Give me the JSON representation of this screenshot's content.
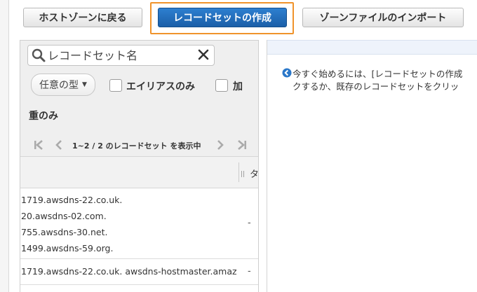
{
  "toolbar": {
    "back_label": "ホストゾーンに戻る",
    "create_label": "レコードセットの作成",
    "import_label": "ゾーンファイルのインポート"
  },
  "filter": {
    "search_placeholder": "レコードセット名",
    "type_select_label": "任意の型",
    "alias_only_label": "エイリアスのみ",
    "weighted_label_part1": "加",
    "weighted_label_part2": "重のみ"
  },
  "pager": {
    "text": "1~2 / 2 のレコードセット を表示中"
  },
  "table": {
    "column_partial_header": "タ",
    "rows": [
      {
        "lines": [
          "1719.awsdns-22.co.uk.",
          "20.awsdns-02.com.",
          "755.awsdns-30.net.",
          "1499.awsdns-59.org."
        ],
        "value": "-"
      },
      {
        "lines": [
          "1719.awsdns-22.co.uk. awsdns-hostmaster.amaz"
        ],
        "value": "-"
      }
    ]
  },
  "info": {
    "line1": "今すぐ始めるには、[レコードセットの作成",
    "line2": "クするか、既存のレコードセットをクリッ"
  },
  "colors": {
    "primary_button": "#1f66b3",
    "highlight_border": "#f0932b",
    "info_icon": "#2a77c9"
  }
}
